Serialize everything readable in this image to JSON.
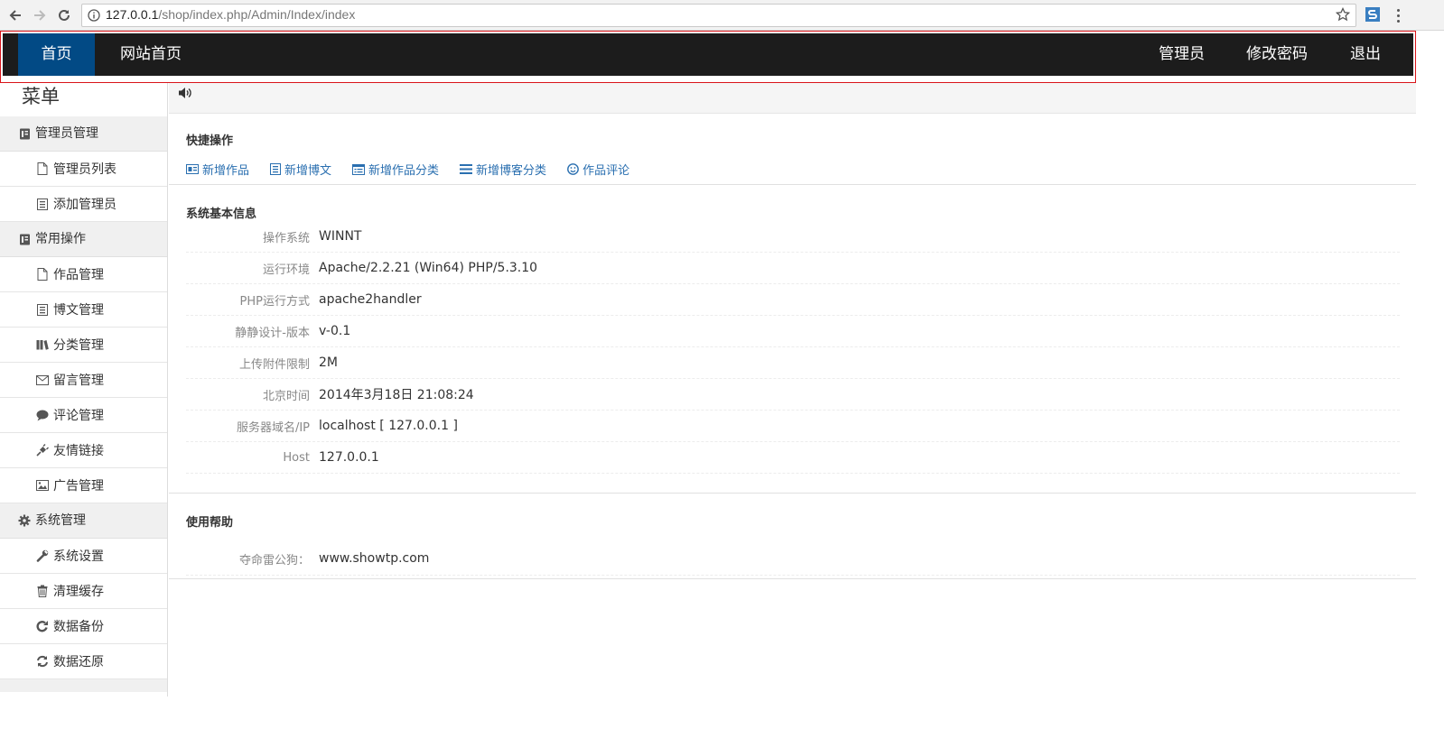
{
  "browser": {
    "url_host": "127.0.0.1",
    "url_path": "/shop/index.php/Admin/Index/index"
  },
  "topnav": {
    "home": "首页",
    "site_home": "网站首页",
    "admin": "管理员",
    "change_password": "修改密码",
    "logout": "退出",
    "bar_color": "#1c1c1c",
    "active_color": "#024a85",
    "frame_color": "#d9151a"
  },
  "sidebar": {
    "title": "菜单",
    "groups": [
      {
        "label": "管理员管理",
        "icon": "book-icon",
        "items": [
          {
            "label": "管理员列表",
            "icon": "file-icon"
          },
          {
            "label": "添加管理员",
            "icon": "list-icon"
          }
        ]
      },
      {
        "label": "常用操作",
        "icon": "book-icon",
        "items": [
          {
            "label": "作品管理",
            "icon": "file-icon"
          },
          {
            "label": "博文管理",
            "icon": "list-icon"
          },
          {
            "label": "分类管理",
            "icon": "books-icon"
          },
          {
            "label": "留言管理",
            "icon": "envelope-icon"
          },
          {
            "label": "评论管理",
            "icon": "comment-icon"
          },
          {
            "label": "友情链接",
            "icon": "plug-icon"
          },
          {
            "label": "广告管理",
            "icon": "picture-icon"
          }
        ]
      },
      {
        "label": "系统管理",
        "icon": "gear-icon",
        "items": [
          {
            "label": "系统设置",
            "icon": "wrench-icon"
          },
          {
            "label": "清理缓存",
            "icon": "trash-icon"
          },
          {
            "label": "数据备份",
            "icon": "rotate-icon"
          },
          {
            "label": "数据还原",
            "icon": "refresh-icon"
          }
        ]
      }
    ]
  },
  "quick_ops": {
    "title": "快捷操作",
    "links": [
      {
        "label": "新增作品",
        "icon": "card-icon"
      },
      {
        "label": "新增博文",
        "icon": "list-icon"
      },
      {
        "label": "新增作品分类",
        "icon": "form-icon"
      },
      {
        "label": "新增博客分类",
        "icon": "bars-icon"
      },
      {
        "label": "作品评论",
        "icon": "smile-icon"
      }
    ],
    "link_color": "#2a6fb0"
  },
  "system_info": {
    "title": "系统基本信息",
    "rows": [
      {
        "key": "操作系统",
        "value": "WINNT"
      },
      {
        "key": "运行环境",
        "value": "Apache/2.2.21 (Win64) PHP/5.3.10"
      },
      {
        "key": "PHP运行方式",
        "value": "apache2handler"
      },
      {
        "key": "静静设计-版本",
        "value": "v-0.1"
      },
      {
        "key": "上传附件限制",
        "value": "2M"
      },
      {
        "key": "北京时间",
        "value": "2014年3月18日 21:08:24"
      },
      {
        "key": "服务器域名/IP",
        "value": "localhost [ 127.0.0.1 ]"
      },
      {
        "key": "Host",
        "value": "127.0.0.1"
      }
    ]
  },
  "help": {
    "title": "使用帮助",
    "rows": [
      {
        "key": "夺命雷公狗：",
        "value": "www.showtp.com"
      }
    ]
  }
}
